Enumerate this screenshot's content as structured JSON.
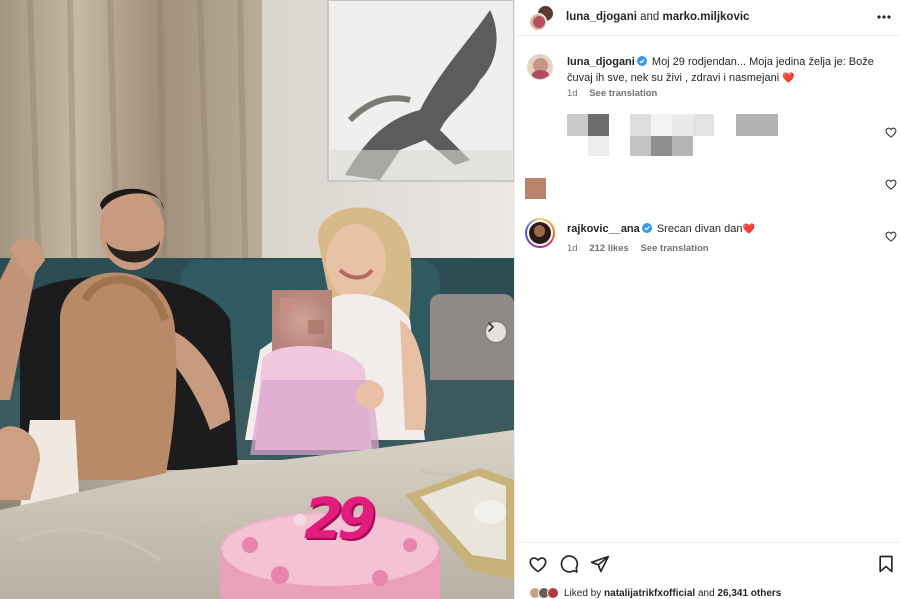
{
  "header": {
    "user1": "luna_djogani",
    "connector": "and",
    "user2": "marko.miljkovic"
  },
  "caption": {
    "username": "luna_djogani",
    "text": "Moj 29 rodjendan... Moja jedina želja je: Bože čuvaj ih sve, nek su živi , zdravi i nasmejani",
    "emoji": "❤️",
    "age": "1d",
    "translate": "See translation"
  },
  "comment": {
    "username": "rajkovic__ana",
    "text": "Srecan divan dan",
    "emoji": "❤️",
    "age": "1d",
    "likes": "212 likes",
    "translate": "See translation"
  },
  "likes_bar": {
    "prefix": "Liked by",
    "user": "natalijatrikfxofficial",
    "suffix": "and",
    "others": "26,341 others"
  },
  "icons": {
    "like": "heart-outline-icon",
    "comment": "comment-bubble-icon",
    "share": "paper-plane-icon",
    "save": "bookmark-icon",
    "more": "more-horizontal-icon",
    "next": "chevron-right-icon"
  },
  "photo": {
    "cake_candle": "29"
  },
  "colors": {
    "verified": "#3897f0",
    "heart": "#ed1c24",
    "muted": "#737373"
  }
}
